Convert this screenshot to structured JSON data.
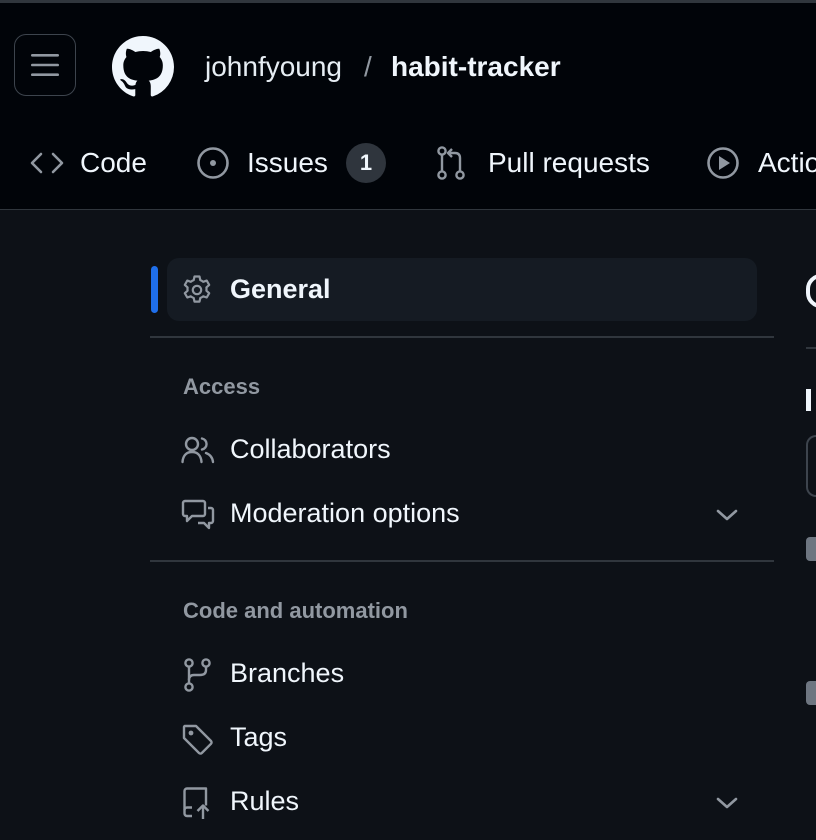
{
  "header": {
    "owner": "johnfyoung",
    "separator": "/",
    "repo": "habit-tracker",
    "menu_icon": "three-bars-icon",
    "logo_icon": "github-mark-icon"
  },
  "nav": {
    "tabs": [
      {
        "label": "Code",
        "icon": "code-icon"
      },
      {
        "label": "Issues",
        "icon": "issue-opened-icon",
        "count": "1"
      },
      {
        "label": "Pull requests",
        "icon": "git-pull-request-icon"
      },
      {
        "label": "Actio",
        "icon": "play-icon"
      }
    ]
  },
  "sidebar": {
    "general": {
      "label": "General",
      "icon": "gear-icon",
      "selected": true
    },
    "sections": [
      {
        "heading": "Access",
        "items": [
          {
            "label": "Collaborators",
            "icon": "people-icon"
          },
          {
            "label": "Moderation options",
            "icon": "comment-discussion-icon",
            "expandable": true
          }
        ]
      },
      {
        "heading": "Code and automation",
        "items": [
          {
            "label": "Branches",
            "icon": "git-branch-icon"
          },
          {
            "label": "Tags",
            "icon": "tag-icon"
          },
          {
            "label": "Rules",
            "icon": "repo-push-icon",
            "expandable": true
          }
        ]
      }
    ]
  },
  "colors": {
    "background": "#0d1117",
    "header_bg": "#010409",
    "accent": "#1f6feb",
    "border": "#30363d",
    "muted_text": "#9198a1"
  }
}
